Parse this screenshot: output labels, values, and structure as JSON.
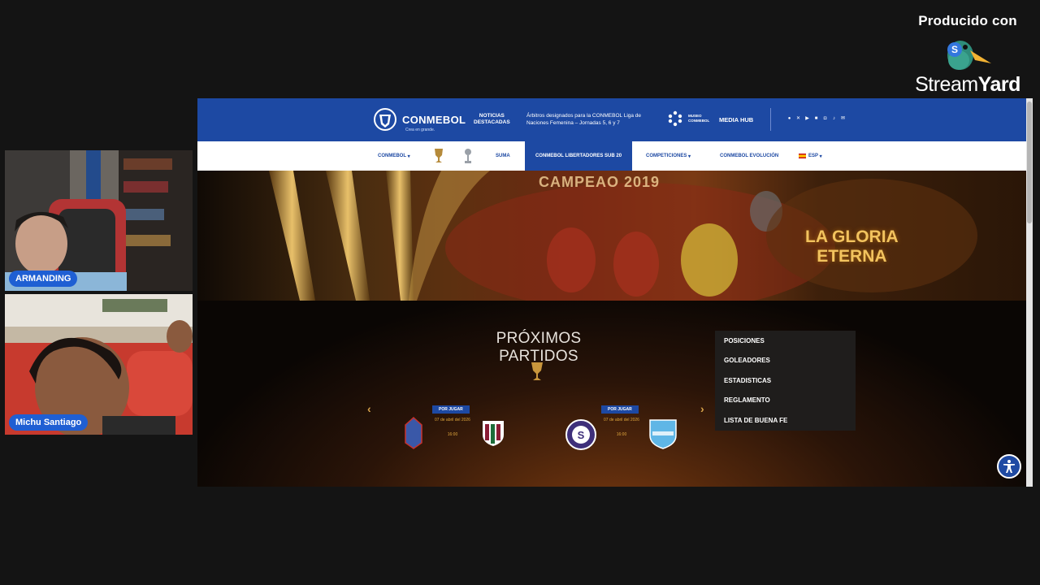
{
  "streamyard": {
    "produced_with": "Producido con",
    "brand_light": "Stream",
    "brand_bold": "Yard"
  },
  "participants": [
    {
      "name": "ARMANDING"
    },
    {
      "name": "Michu Santiago"
    }
  ],
  "conmebol_site": {
    "header": {
      "logo_text": "CONMEBOL",
      "logo_tagline": "Crea en grande.",
      "news_label_line1": "NOTICIAS",
      "news_label_line2": "DESTACADAS",
      "news_text": "Árbitros designados para la CONMEBOL Liga de Naciones Femenina – Jornadas 5, 6 y 7",
      "museo_line1": "MUSEO",
      "museo_line2": "CONMEBOL",
      "media_hub": "MEDIA HUB"
    },
    "nav": {
      "conmebol": "CONMEBOL",
      "suma": "SUMA",
      "libertadores": "CONMEBOL LIBERTADORES SUB 20",
      "competiciones": "COMPETICIONES",
      "evolucion": "CONMEBOL EVOLUCIÓN",
      "language": "ESP"
    },
    "hero": {
      "banner_text": "CAMPEAO 2019",
      "headline_line1": "LA GLORIA",
      "headline_line2": "ETERNA"
    },
    "matches_section": {
      "title": "PRÓXIMOS PARTIDOS",
      "matches": [
        {
          "status": "POR JUGAR",
          "date": "07 de abril del 2026",
          "time": "16:00"
        },
        {
          "status": "POR JUGAR",
          "date": "07 de abril del 2026",
          "time": "16:00"
        }
      ]
    },
    "dropdown_menu": [
      "POSICIONES",
      "GOLEADORES",
      "ESTADISTICAS",
      "REGLAMENTO",
      "LISTA DE BUENA FE"
    ]
  },
  "colors": {
    "conmebol_blue": "#1d49a3",
    "badge_blue": "#1f5fd3",
    "gold": "#e0a73d"
  }
}
